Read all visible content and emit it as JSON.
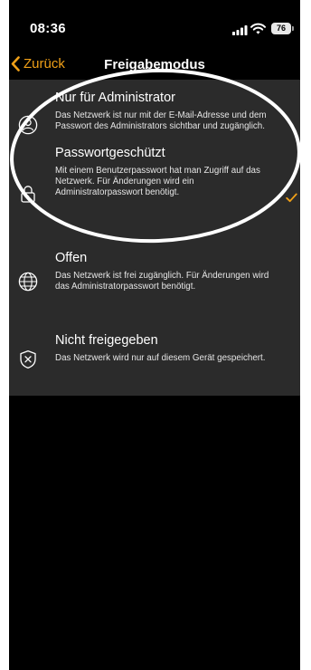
{
  "status": {
    "time": "08:36",
    "battery": "76"
  },
  "nav": {
    "back_label": "Zurück",
    "title": "Freigabemodus"
  },
  "options": [
    {
      "title": "Nur für Administrator",
      "desc": "Das Netzwerk ist nur mit der E-Mail-Adresse und dem Passwort des Administrators sichtbar und zugänglich.",
      "icon": "admin-user-icon",
      "selected": false
    },
    {
      "title": "Passwortgeschützt",
      "desc": "Mit einem Benutzerpasswort hat man Zugriff auf das Netzwerk. Für Änderungen wird ein Administratorpasswort benötigt.",
      "icon": "lock-icon",
      "selected": true
    },
    {
      "title": "Offen",
      "desc": "Das Netzwerk ist frei zugänglich. Für Änderungen wird das Administratorpasswort benötigt.",
      "icon": "globe-icon",
      "selected": false
    },
    {
      "title": "Nicht freigegeben",
      "desc": "Das Netzwerk wird nur auf diesem Gerät gespeichert.",
      "icon": "shield-x-icon",
      "selected": false
    }
  ],
  "colors": {
    "accent": "#f0a018",
    "panel": "#2b2b2b",
    "background": "#000000",
    "annotation": "#ffffff"
  }
}
